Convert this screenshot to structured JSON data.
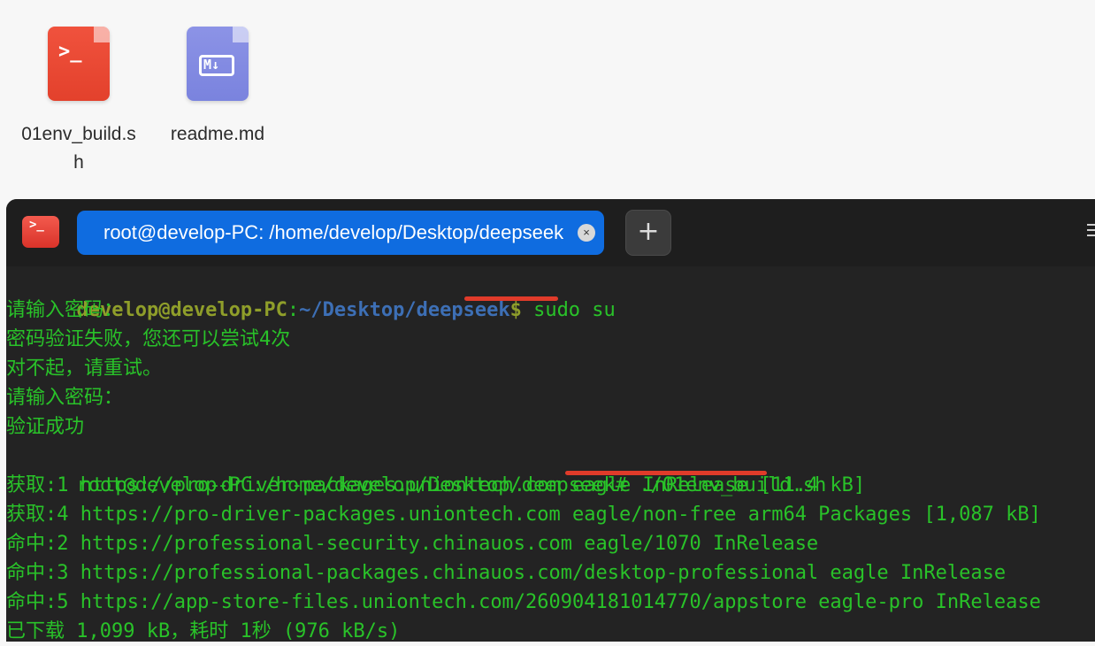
{
  "desktop": {
    "files": [
      {
        "name": "01env_build.sh",
        "line1": "01env_build.s",
        "line2": "h",
        "icon": "terminal-script-icon",
        "glyph": ">_"
      },
      {
        "name": "readme.md",
        "line1": "readme.md",
        "line2": "",
        "icon": "markdown-icon",
        "glyph": "M↓"
      }
    ]
  },
  "terminal": {
    "tab_title": "root@develop-PC: /home/develop/Desktop/deepseek",
    "tab_close": "×",
    "new_tab": "+",
    "lines": [
      {
        "user": "develop@develop-PC",
        "colon": ":",
        "path": "~/Desktop/deepseek",
        "dollar": "$",
        "cmd": " sudo su"
      },
      {
        "text": "请输入密码："
      },
      {
        "text": "密码验证失败，您还可以尝试4次"
      },
      {
        "text": "对不起，请重试。"
      },
      {
        "text": "请输入密码："
      },
      {
        "text": "验证成功"
      },
      {
        "prompt": "root@develop-PC:/home/develop/Desktop/deepseek#",
        "cmd": " ./01env_build.sh"
      },
      {
        "text": "获取:1 https://pro-driver-packages.uniontech.com eagle InRelease [11.4 kB]"
      },
      {
        "text": "获取:4 https://pro-driver-packages.uniontech.com eagle/non-free arm64 Packages [1,087 kB]"
      },
      {
        "text": "命中:2 https://professional-security.chinauos.com eagle/1070 InRelease"
      },
      {
        "text": "命中:3 https://professional-packages.chinauos.com/desktop-professional eagle InRelease"
      },
      {
        "text": "命中:5 https://app-store-files.uniontech.com/260904181014770/appstore eagle-pro InRelease"
      },
      {
        "text": "已下载 1,099 kB，耗时 1秒 (976 kB/s)"
      }
    ]
  },
  "colors": {
    "terminal_bg": "#232323",
    "output_green": "#29c229",
    "user_olive": "#8f9e2a",
    "path_blue": "#3d6fb5",
    "tab_blue": "#0f6ce0",
    "annotation_red": "#e03b2a"
  }
}
